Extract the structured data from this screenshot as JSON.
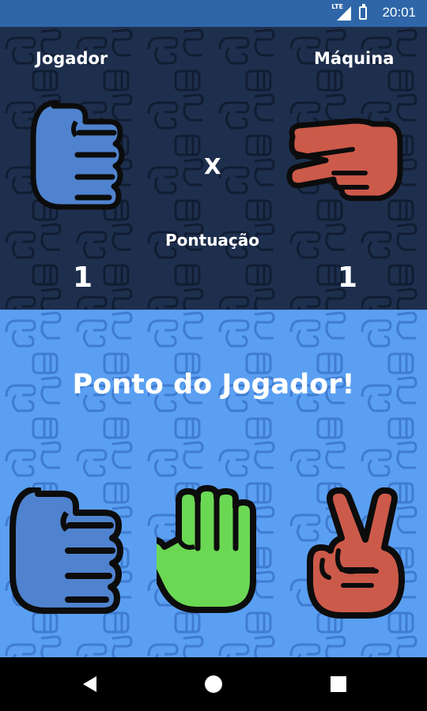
{
  "status_bar": {
    "time": "20:01",
    "network": "LTE"
  },
  "scoreboard": {
    "player_label": "Jogador",
    "machine_label": "Máquina",
    "versus": "X",
    "score_title": "Pontuação",
    "player_score": "1",
    "machine_score": "1",
    "player_choice": "rock-icon",
    "machine_choice": "scissors-icon"
  },
  "result_message": "Ponto do Jogador!",
  "choices": [
    {
      "name": "rock",
      "icon": "rock-icon",
      "color": "#4f83cf"
    },
    {
      "name": "paper",
      "icon": "paper-icon",
      "color": "#6bd854"
    },
    {
      "name": "scissors",
      "icon": "scissors-icon",
      "color": "#cc5a4a"
    }
  ],
  "colors": {
    "top_bg": "#1e2f4e",
    "bottom_bg": "#5a9ff2",
    "status_bar": "#2e66a8"
  }
}
